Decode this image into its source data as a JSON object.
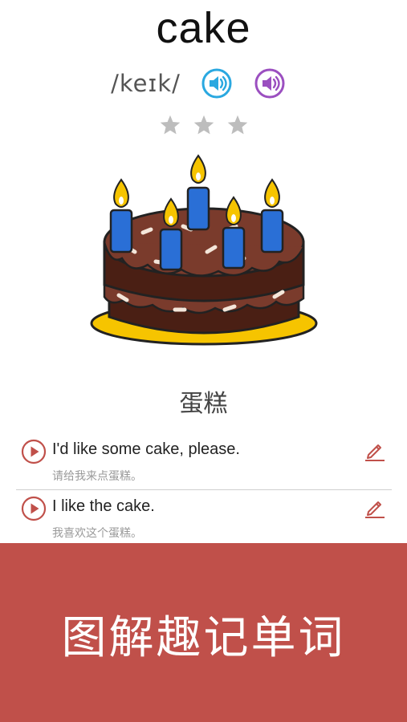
{
  "word": "cake",
  "phonetic": "/keɪk/",
  "speaker_uk_icon": "speaker-icon",
  "speaker_us_icon": "speaker-icon",
  "rating": {
    "filled": 0,
    "total": 3
  },
  "translation": "蛋糕",
  "examples": [
    {
      "en": "I'd like some cake, please.",
      "zh": "请给我来点蛋糕。"
    },
    {
      "en": "I like the cake.",
      "zh": "我喜欢这个蛋糕。"
    }
  ],
  "banner": {
    "text": "图解趣记单词"
  },
  "colors": {
    "accent_red": "#c0504a",
    "speaker_blue": "#2aa8e0",
    "speaker_purple": "#9b4fc0",
    "star_gray": "#bdbdbd"
  }
}
